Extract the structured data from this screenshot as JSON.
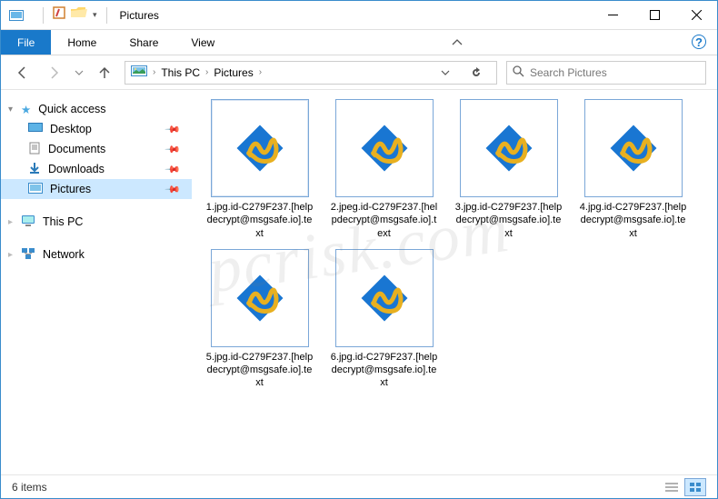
{
  "titlebar": {
    "title": "Pictures"
  },
  "tabs": {
    "file": "File",
    "home": "Home",
    "share": "Share",
    "view": "View"
  },
  "breadcrumb": {
    "c0": "This PC",
    "c1": "Pictures"
  },
  "search": {
    "placeholder": "Search Pictures"
  },
  "nav": {
    "quick": "Quick access",
    "desktop": "Desktop",
    "documents": "Documents",
    "downloads": "Downloads",
    "pictures": "Pictures",
    "thispc": "This PC",
    "network": "Network"
  },
  "files": {
    "f0": "1.jpg.id-C279F237.[helpdecrypt@msgsafe.io].text",
    "f1": "2.jpeg.id-C279F237.[helpdecrypt@msgsafe.io].text",
    "f2": "3.jpg.id-C279F237.[helpdecrypt@msgsafe.io].text",
    "f3": "4.jpg.id-C279F237.[helpdecrypt@msgsafe.io].text",
    "f4": "5.jpg.id-C279F237.[helpdecrypt@msgsafe.io].text",
    "f5": "6.jpg.id-C279F237.[helpdecrypt@msgsafe.io].text"
  },
  "status": {
    "count": "6 items"
  },
  "watermark": "pcrisk.com"
}
